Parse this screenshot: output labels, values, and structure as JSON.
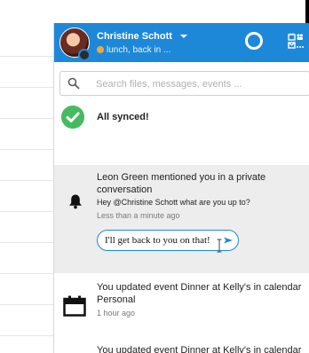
{
  "header": {
    "user_name": "Christine Schott",
    "status_text": "lunch, back in ...",
    "avatar_icon": "user-avatar",
    "logo_icon": "app-logo-icon",
    "apps_icon": "apps-icon"
  },
  "search": {
    "placeholder": "Search files, messages, events ..."
  },
  "sync": {
    "label": "All synced!"
  },
  "mention": {
    "title": "Leon Green mentioned you in a private conversation",
    "message": "Hey @Christine Schott what are you up to?",
    "time": "Less than a minute ago",
    "reply_value": "I'll get back to you on that!"
  },
  "events": [
    {
      "title": "You updated event Dinner at Kelly's in calendar Personal",
      "time": "1 hour ago"
    },
    {
      "title": "You updated event Dinner at Kelly's in calendar",
      "time": ""
    }
  ],
  "colors": {
    "header": "#1e88d8",
    "synced": "#46ba61",
    "mention_bg": "#ededed"
  }
}
